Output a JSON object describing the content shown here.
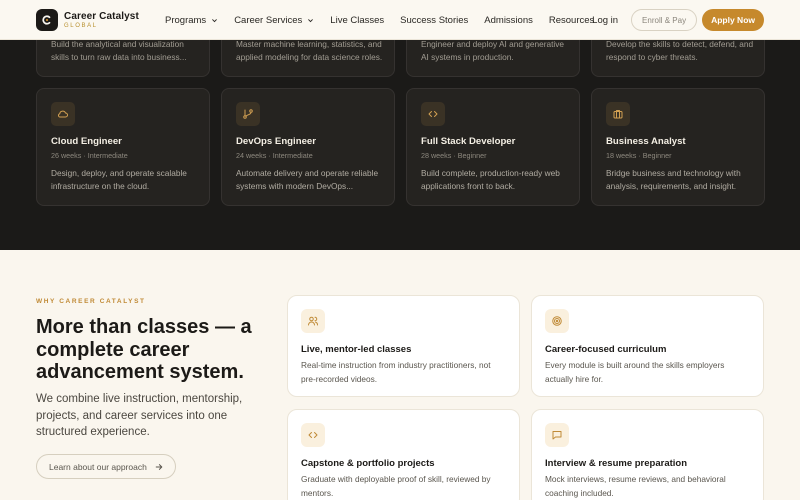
{
  "brand": {
    "name": "Career Catalyst",
    "sub": "GLOBAL",
    "accent": "#c6892c"
  },
  "nav": {
    "items": [
      {
        "label": "Programs",
        "dropdown": true
      },
      {
        "label": "Career Services",
        "dropdown": true
      },
      {
        "label": "Live Classes",
        "dropdown": false
      },
      {
        "label": "Success Stories",
        "dropdown": false
      },
      {
        "label": "Admissions",
        "dropdown": false
      },
      {
        "label": "Resources",
        "dropdown": false
      }
    ],
    "login": "Log in",
    "enroll": "Enroll & Pay",
    "apply": "Apply Now"
  },
  "programs_top": [
    {
      "desc": "Build the analytical and visualization skills to turn raw data into business..."
    },
    {
      "desc": "Master machine learning, statistics, and applied modeling for data science roles."
    },
    {
      "desc": "Engineer and deploy AI and generative AI systems in production."
    },
    {
      "desc": "Develop the skills to detect, defend, and respond to cyber threats."
    }
  ],
  "programs": [
    {
      "icon": "cloud-icon",
      "title": "Cloud Engineer",
      "meta": "26 weeks · Intermediate",
      "desc": "Design, deploy, and operate scalable infrastructure on the cloud."
    },
    {
      "icon": "git-branch-icon",
      "title": "DevOps Engineer",
      "meta": "24 weeks · Intermediate",
      "desc": "Automate delivery and operate reliable systems with modern DevOps..."
    },
    {
      "icon": "code-icon",
      "title": "Full Stack Developer",
      "meta": "28 weeks · Beginner",
      "desc": "Build complete, production-ready web applications front to back."
    },
    {
      "icon": "briefcase-icon",
      "title": "Business Analyst",
      "meta": "18 weeks · Beginner",
      "desc": "Bridge business and technology with analysis, requirements, and insight."
    }
  ],
  "why": {
    "eyebrow": "WHY CAREER CATALYST",
    "headline": "More than classes — a complete career advancement system.",
    "lead": "We combine live instruction, mentorship, projects, and career services into one structured experience.",
    "cta": "Learn about our approach"
  },
  "features": [
    {
      "icon": "users-icon",
      "title": "Live, mentor-led classes",
      "desc": "Real-time instruction from industry practitioners, not pre-recorded videos."
    },
    {
      "icon": "target-icon",
      "title": "Career-focused curriculum",
      "desc": "Every module is built around the skills employers actually hire for."
    },
    {
      "icon": "code-icon",
      "title": "Capstone & portfolio projects",
      "desc": "Graduate with deployable proof of skill, reviewed by mentors."
    },
    {
      "icon": "chat-icon",
      "title": "Interview & resume preparation",
      "desc": "Mock interviews, resume reviews, and behavioral coaching included."
    }
  ]
}
